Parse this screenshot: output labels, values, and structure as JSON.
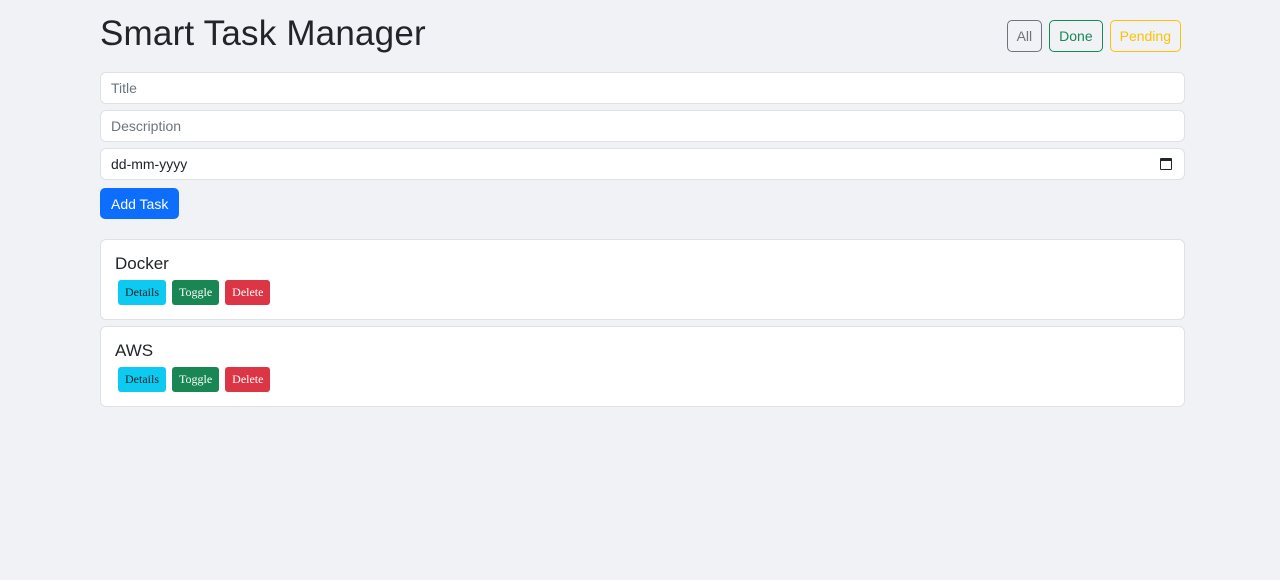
{
  "header": {
    "title": "Smart Task Manager",
    "filters": {
      "all": "All",
      "done": "Done",
      "pending": "Pending"
    }
  },
  "form": {
    "title_placeholder": "Title",
    "description_placeholder": "Description",
    "date_value": "dd-mm-yyyy",
    "add_label": "Add Task"
  },
  "tasks": [
    {
      "title": "Docker",
      "details_label": "Details",
      "toggle_label": "Toggle",
      "delete_label": "Delete"
    },
    {
      "title": "AWS",
      "details_label": "Details",
      "toggle_label": "Toggle",
      "delete_label": "Delete"
    }
  ],
  "colors": {
    "background": "#f0f2f5",
    "primary": "#0d6efd",
    "info": "#0dcaf0",
    "success": "#198754",
    "danger": "#dc3545",
    "warning": "#ffc107",
    "secondary": "#6c757d"
  },
  "icons": {
    "date": "calendar-icon"
  }
}
